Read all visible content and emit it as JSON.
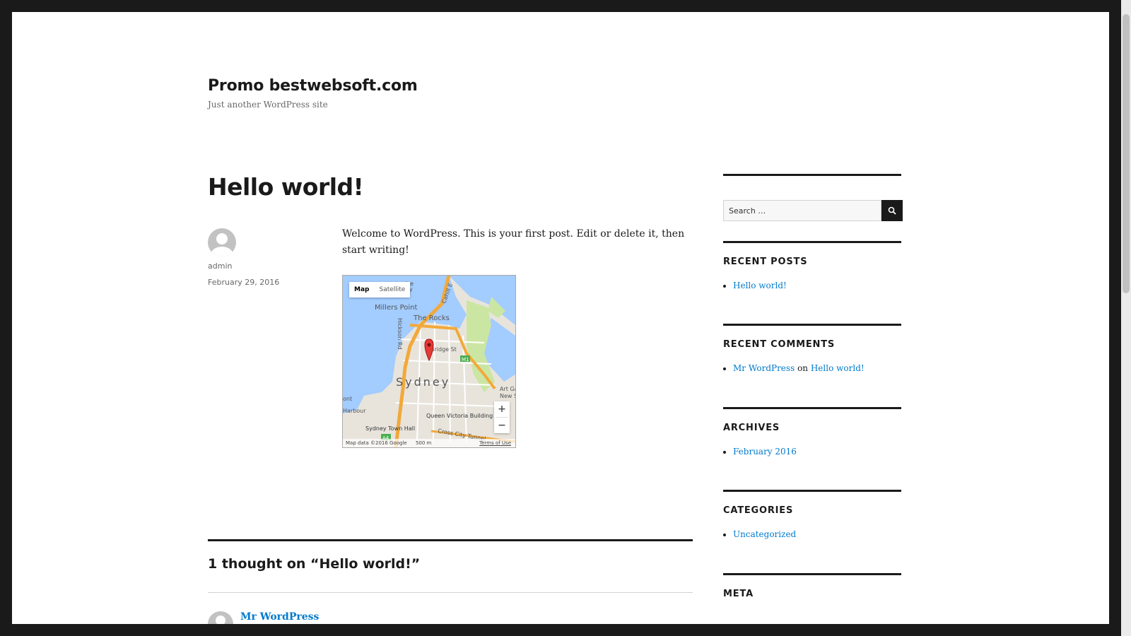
{
  "site": {
    "title": "Promo bestwebsoft.com",
    "description": "Just another WordPress site"
  },
  "post": {
    "title": "Hello world!",
    "author": "admin",
    "date": "February 29, 2016",
    "content": "Welcome to WordPress. This is your first post. Edit or delete it, then start writing!"
  },
  "map": {
    "type_active": "Map",
    "type_inactive": "Satellite",
    "zoom_in": "+",
    "zoom_out": "−",
    "labels": {
      "millers_point": "Millers Point",
      "the_rocks": "The Rocks",
      "hickson_rd": "Hickson Rd",
      "bridge_st": "Bridge St",
      "sydney": "Sydney",
      "qvb": "Queen Victoria Building",
      "town_hall": "Sydney Town Hall",
      "cross_city": "Cross City Tunnel",
      "harbour": "Harbour",
      "art_ga": "Art Ga",
      "new_s": "New S",
      "cahill": "Cahill E",
      "m1": "M1",
      "a4": "A4",
      "atre": "atre",
      "any": "any",
      "ont": "ont"
    },
    "footer_data": "Map data ©2016 Google",
    "scale": "500 m",
    "terms": "Terms of Use",
    "colors": {
      "water": "#a3ccff",
      "land": "#e8e4dc",
      "park": "#cbe6a3",
      "road": "#f2a93b",
      "pin": "#e53935"
    }
  },
  "comments": {
    "title": "1 thought on “Hello world!”",
    "first_author": "Mr WordPress"
  },
  "sidebar": {
    "search_placeholder": "Search …",
    "recent_posts": {
      "title": "Recent Posts",
      "items": [
        "Hello world!"
      ]
    },
    "recent_comments": {
      "title": "Recent Comments",
      "author": "Mr WordPress",
      "on": "on",
      "post": "Hello world!"
    },
    "archives": {
      "title": "Archives",
      "items": [
        "February 2016"
      ]
    },
    "categories": {
      "title": "Categories",
      "items": [
        "Uncategorized"
      ]
    },
    "meta": {
      "title": "Meta"
    }
  },
  "theme": {
    "link_color": "#007acc",
    "text_color": "#1a1a1a",
    "frame_color": "#1a1a1a"
  }
}
